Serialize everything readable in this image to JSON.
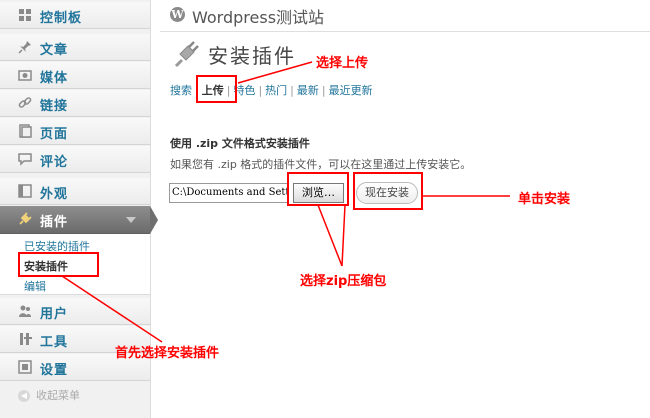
{
  "sidebar": {
    "items": [
      {
        "label": "控制板",
        "icon": "dashboard-icon"
      },
      {
        "label": "文章",
        "icon": "pin-icon"
      },
      {
        "label": "媒体",
        "icon": "media-icon"
      },
      {
        "label": "链接",
        "icon": "link-icon"
      },
      {
        "label": "页面",
        "icon": "page-icon"
      },
      {
        "label": "评论",
        "icon": "comment-icon"
      },
      {
        "label": "外观",
        "icon": "appearance-icon"
      },
      {
        "label": "插件",
        "icon": "plugin-icon"
      },
      {
        "label": "用户",
        "icon": "users-icon"
      },
      {
        "label": "工具",
        "icon": "tools-icon"
      },
      {
        "label": "设置",
        "icon": "settings-icon"
      }
    ],
    "plugin_submenu": [
      "已安装的插件",
      "安装插件",
      "编辑"
    ],
    "collapse_label": "收起菜单"
  },
  "header": {
    "site_title": "Wordpress测试站",
    "page_title": "安装插件"
  },
  "tabs": [
    "搜索",
    "上传",
    "特色",
    "热门",
    "最新",
    "最近更新"
  ],
  "upload": {
    "heading": "使用 .zip 文件格式安装插件",
    "description": "如果您有 .zip 格式的插件文件，可以在这里通过上传安装它。",
    "file_value": "C:\\Documents and Sett",
    "browse_label": "浏览…",
    "install_label": "现在安装"
  },
  "annotations": {
    "upload_tab": "选择上传",
    "install": "单击安装",
    "zip": "选择zip压缩包",
    "first_step": "首先选择安装插件"
  },
  "colors": {
    "link": "#21759b",
    "annotation": "#ff0000",
    "active_menu": "#6f6f6f"
  }
}
